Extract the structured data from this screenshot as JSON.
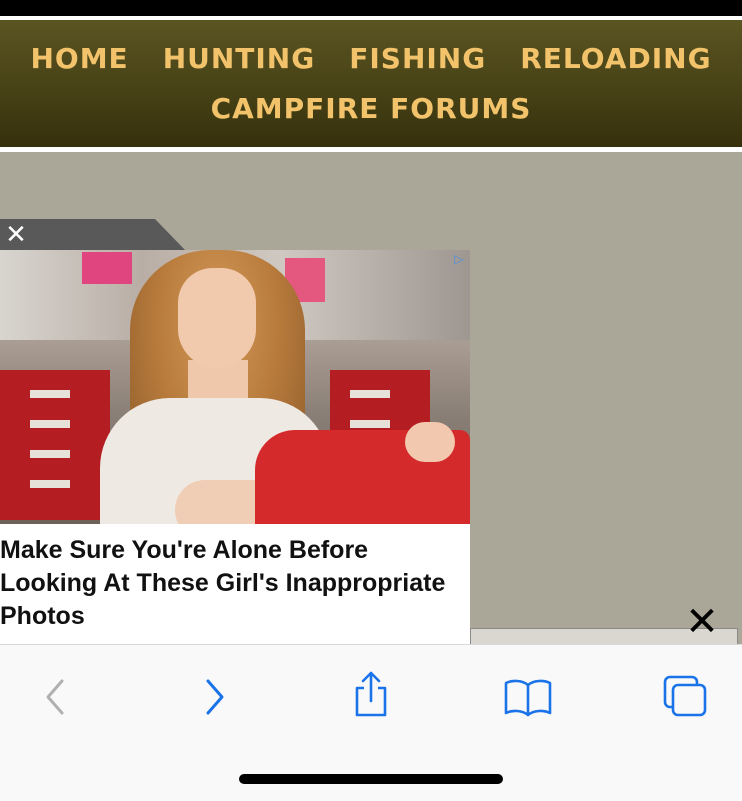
{
  "nav": {
    "links": [
      "HOME",
      "HUNTING",
      "FISHING",
      "RELOADING",
      "CAMPFIRE FORUMS"
    ]
  },
  "ad": {
    "headline": "Make Sure You're Alone Before Looking At These Girl's Inappropriate Photos",
    "tab_close_icon": "close-icon",
    "badge_icon": "adchoices-icon"
  },
  "overlay": {
    "close_icon": "close-icon"
  },
  "toolbar": {
    "buttons": [
      {
        "name": "back",
        "icon": "chevron-left-icon",
        "enabled": false
      },
      {
        "name": "forward",
        "icon": "chevron-right-icon",
        "enabled": true
      },
      {
        "name": "share",
        "icon": "share-icon",
        "enabled": true
      },
      {
        "name": "bookmarks",
        "icon": "book-icon",
        "enabled": true
      },
      {
        "name": "tabs",
        "icon": "tabs-icon",
        "enabled": true
      }
    ]
  },
  "colors": {
    "nav_link": "#f2c36b",
    "nav_bg": "#474216",
    "page_bg": "#aaa698",
    "toolbar_enabled": "#1a73e8",
    "toolbar_disabled": "#b0b0b0"
  }
}
